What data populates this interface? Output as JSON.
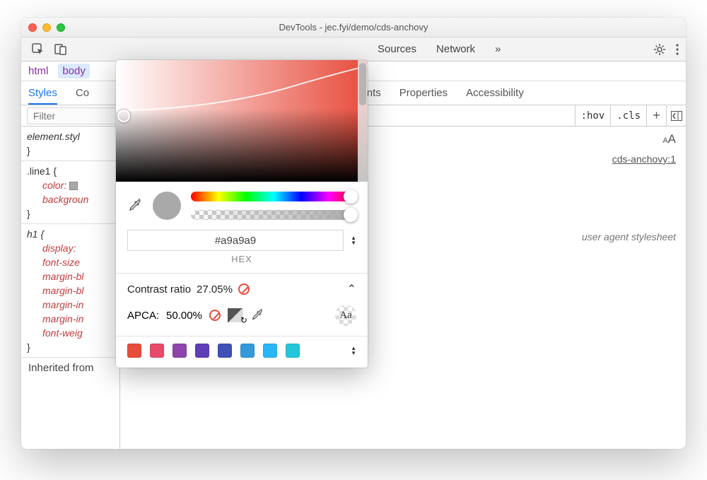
{
  "window": {
    "title": "DevTools - jec.fyi/demo/cds-anchovy"
  },
  "toolbar": {
    "tabs": [
      "Sources",
      "Network"
    ],
    "overflow": "»"
  },
  "crumbs": {
    "html": "html",
    "body": "body"
  },
  "subtabs": {
    "styles": "Styles",
    "computed": "Co",
    "layout": "",
    "breakpoints": "l Breakpoints",
    "properties": "Properties",
    "accessibility": "Accessibility"
  },
  "filter": {
    "placeholder": "Filter",
    "hov": ":hov",
    "cls": ".cls",
    "plus": "+"
  },
  "rules": {
    "element": {
      "selector": "element.styl",
      "close": "}"
    },
    "line1": {
      "selector": ".line1 {",
      "color_prop": "color:",
      "bg_prop": "backgroun",
      "close": "}"
    },
    "h1": {
      "selector": "h1 {",
      "props": [
        "display:",
        "font-size",
        "margin-bl",
        "margin-bl",
        "margin-in",
        "margin-in",
        "font-weig"
      ],
      "close": "}"
    },
    "inherited": "Inherited from"
  },
  "rightpane": {
    "aa_icon": "AA",
    "source_link": "cds-anchovy:1",
    "uas": "user agent stylesheet"
  },
  "picker": {
    "hex_value": "#a9a9a9",
    "hex_label": "HEX",
    "contrast_label": "Contrast ratio",
    "contrast_value": "27.05%",
    "apca_label": "APCA:",
    "apca_value": "50.00%",
    "aa_sample": "Aa",
    "swatches": [
      "#e74c3c",
      "#e84a6b",
      "#8e44ad",
      "#5e3fb5",
      "#3f51b5",
      "#3498db",
      "#29b6f6",
      "#26c6da"
    ]
  }
}
